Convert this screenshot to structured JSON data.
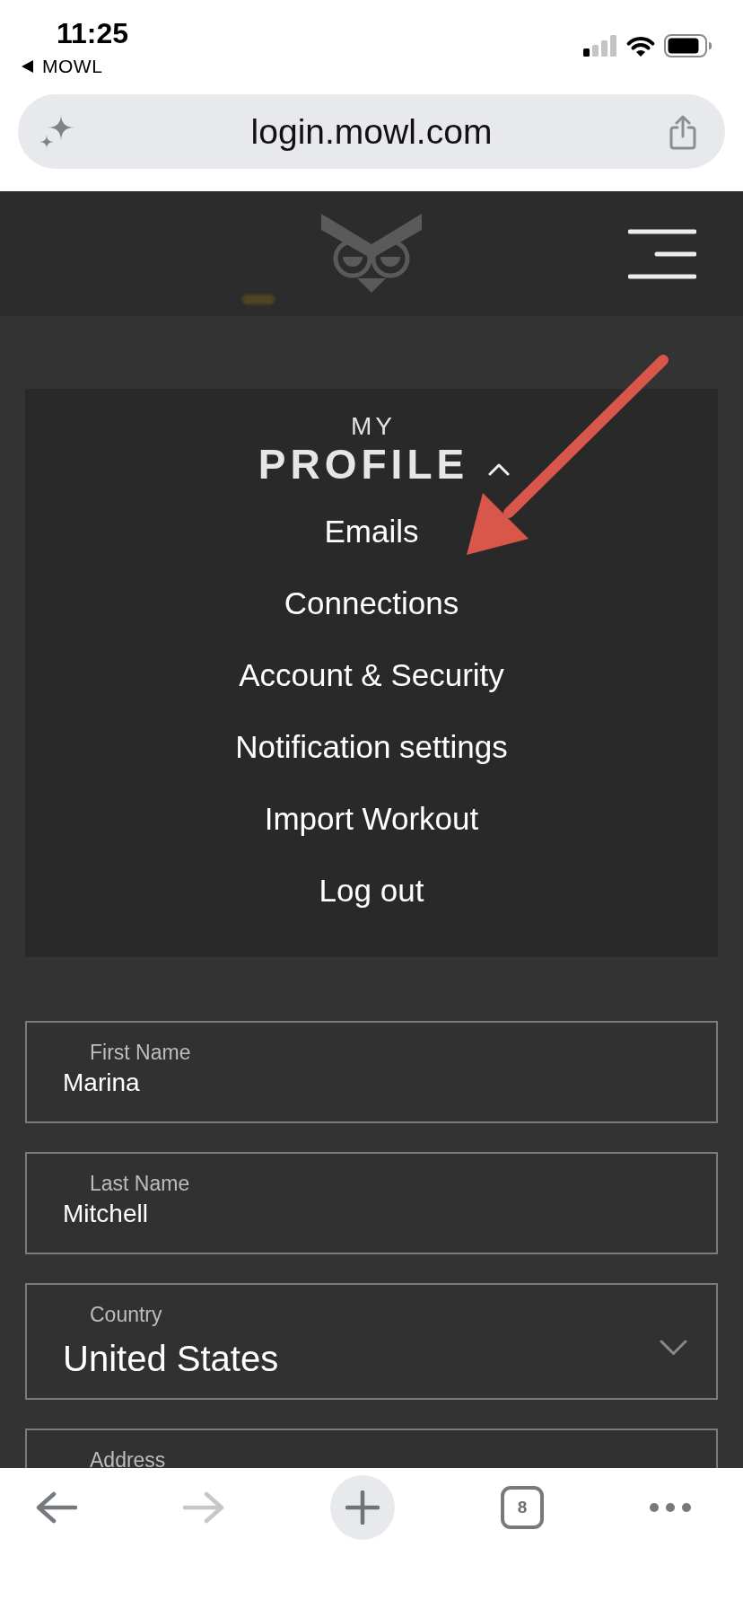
{
  "status_bar": {
    "time": "11:25",
    "back_app": "MOWL"
  },
  "address_bar": {
    "url": "login.mowl.com"
  },
  "profile_menu": {
    "eyebrow": "MY",
    "title": "PROFILE",
    "expanded": true,
    "items": [
      "Emails",
      "Connections",
      "Account & Security",
      "Notification settings",
      "Import Workout",
      "Log out"
    ]
  },
  "form": {
    "fields": [
      {
        "kind": "text",
        "label": "First Name",
        "value": "Marina"
      },
      {
        "kind": "text",
        "label": "Last Name",
        "value": "Mitchell"
      },
      {
        "kind": "select",
        "label": "Country",
        "value": "United States"
      },
      {
        "kind": "text",
        "label": "Address"
      }
    ]
  },
  "toolbar": {
    "buttons": [
      {
        "kind": "back",
        "disabled": false
      },
      {
        "kind": "forward",
        "disabled": true
      },
      {
        "kind": "new_tab",
        "disabled": false
      },
      {
        "kind": "tabs",
        "count": "8",
        "disabled": false
      },
      {
        "kind": "more",
        "disabled": false
      }
    ]
  }
}
